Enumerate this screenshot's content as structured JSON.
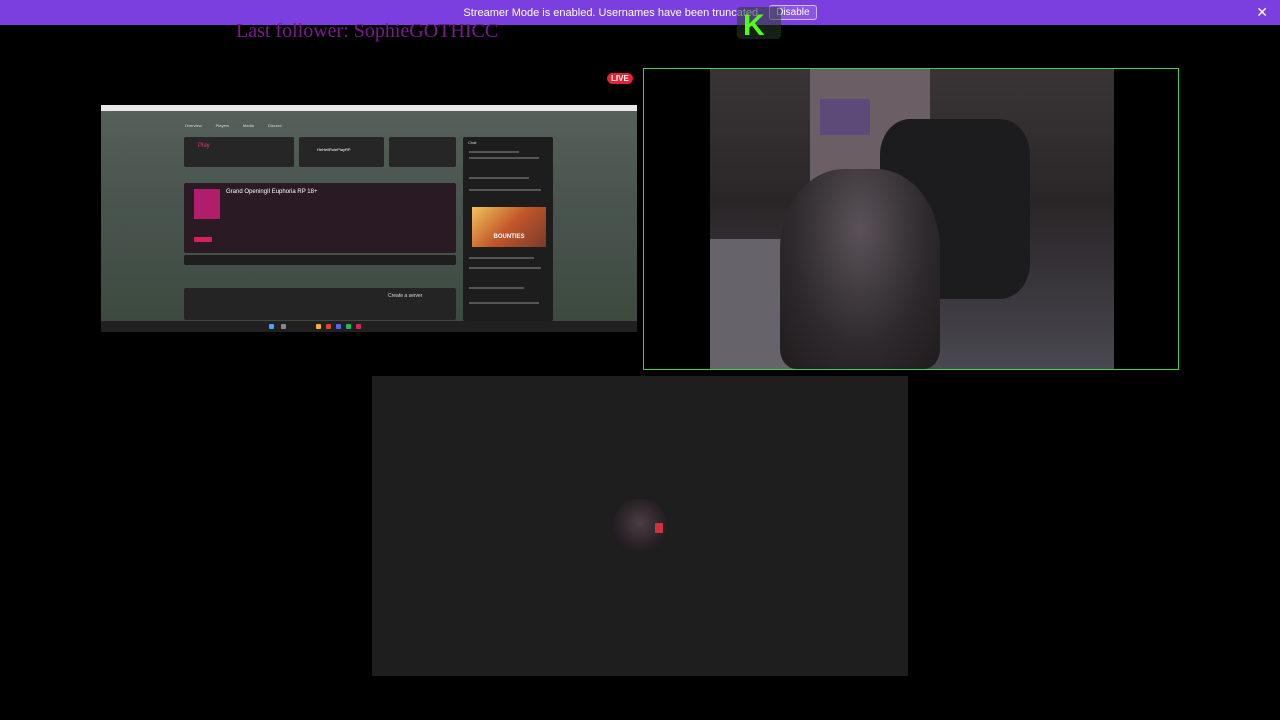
{
  "banner": {
    "message": "Streamer Mode is enabled. Usernames have been truncated.",
    "button_label": "Disable",
    "close_icon": "close-icon"
  },
  "overlay": {
    "last_follower": "Last follower: SophieGOTHICC",
    "live_badge": "LIVE",
    "logo_text": "K"
  },
  "screen_share": {
    "nav_items": [
      "Overview",
      "Players",
      "Media",
      "Discord"
    ],
    "play_title": "Play",
    "last_server_name": "HeHellRolePlayRP",
    "server_title": "Grand OpeningIl Euphoria RP 18+",
    "create_server": "Create a server",
    "chat_title": "Chat",
    "bounties_label": "BOUNTIES"
  },
  "colors": {
    "banner": "#7b3fe0",
    "live": "#e52238",
    "webcam_border": "#3ecf5a",
    "follower_text": "#7a1a8c"
  }
}
